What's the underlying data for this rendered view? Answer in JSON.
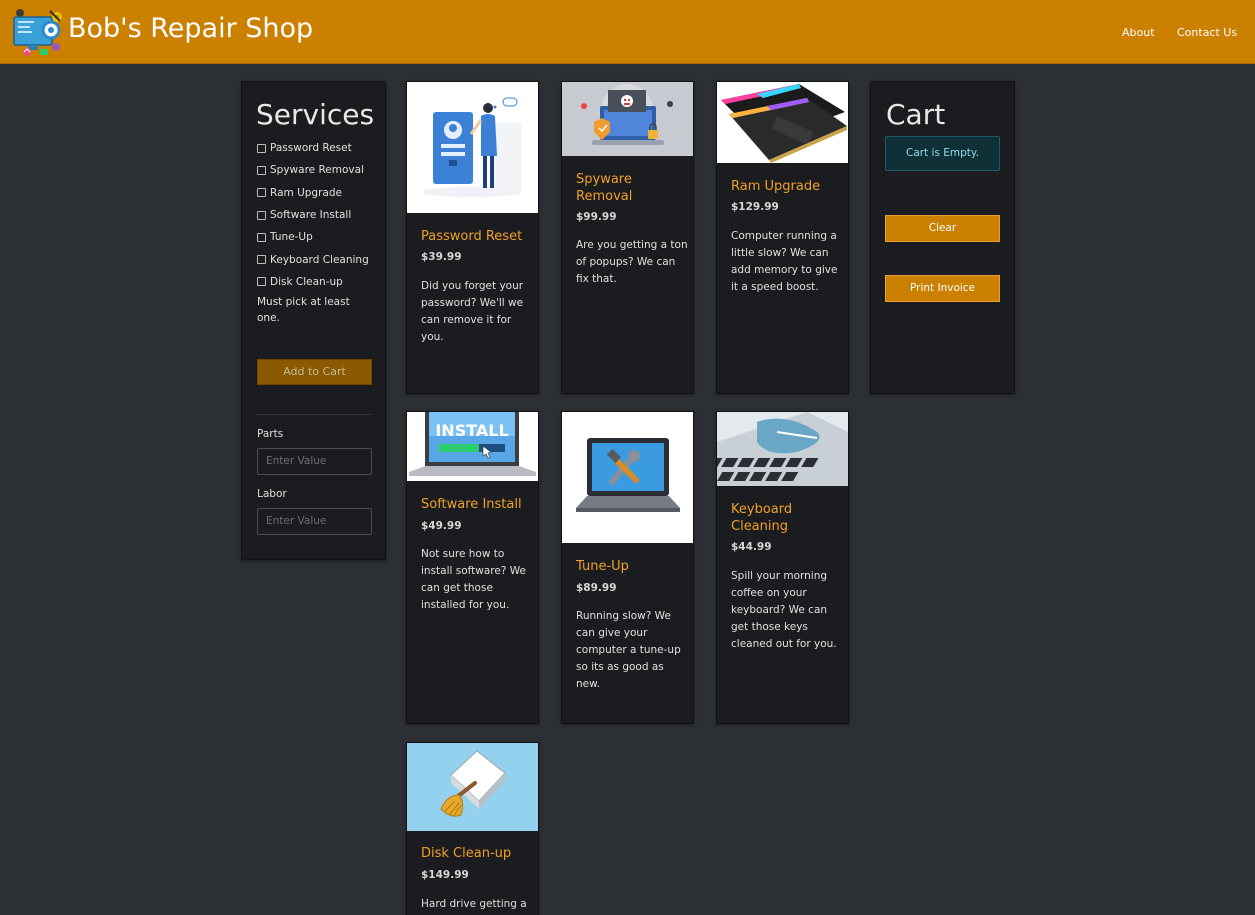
{
  "header": {
    "brand": "Bob's Repair Shop",
    "nav": [
      {
        "label": "About"
      },
      {
        "label": "Contact Us"
      }
    ],
    "bg_color": "#cc8000"
  },
  "services": {
    "title": "Services",
    "items": [
      {
        "label": "Password Reset"
      },
      {
        "label": "Spyware Removal"
      },
      {
        "label": "Ram Upgrade"
      },
      {
        "label": "Software Install"
      },
      {
        "label": "Tune-Up"
      },
      {
        "label": "Keyboard Cleaning"
      },
      {
        "label": "Disk Clean-up"
      }
    ],
    "note": "Must pick at least one.",
    "add_button": "Add to Cart",
    "parts_label": "Parts",
    "parts_placeholder": "Enter Value",
    "labor_label": "Labor",
    "labor_placeholder": "Enter Value"
  },
  "products": [
    {
      "title": "Password Reset",
      "price": "$39.99",
      "desc": "Did you forget your password? We'll we can remove it for you.",
      "image": "password-reset-illustration"
    },
    {
      "title": "Spyware Removal",
      "price": "$99.99",
      "desc": "Are you getting a ton of popups? We can fix that.",
      "image": "spyware-laptop-image"
    },
    {
      "title": "Ram Upgrade",
      "price": "$129.99",
      "desc": "Computer running a little slow? We can add memory to give it a speed boost.",
      "image": "ram-sticks-image"
    },
    {
      "title": "Software Install",
      "price": "$49.99",
      "desc": "Not sure how to install software? We can get those installed for you.",
      "image": "install-laptop-image"
    },
    {
      "title": "Tune-Up",
      "price": "$89.99",
      "desc": "Running slow? We can give your computer a tune-up so its as good as new.",
      "image": "tune-up-laptop-image"
    },
    {
      "title": "Keyboard Cleaning",
      "price": "$44.99",
      "desc": "Spill your morning coffee on your keyboard? We can get those keys cleaned out for you.",
      "image": "keyboard-cleaning-image"
    },
    {
      "title": "Disk Clean-up",
      "price": "$149.99",
      "desc": "Hard drive getting a",
      "image": "disk-cleanup-icon"
    }
  ],
  "cart": {
    "title": "Cart",
    "empty_text": "Cart is Empty.",
    "clear_button": "Clear",
    "print_button": "Print Invoice"
  },
  "colors": {
    "accent": "#cc8000",
    "title_orange": "#f0a028",
    "page_bg": "#2c2f33",
    "panel_bg": "#1b1c1f",
    "alert_bg": "#103038"
  }
}
